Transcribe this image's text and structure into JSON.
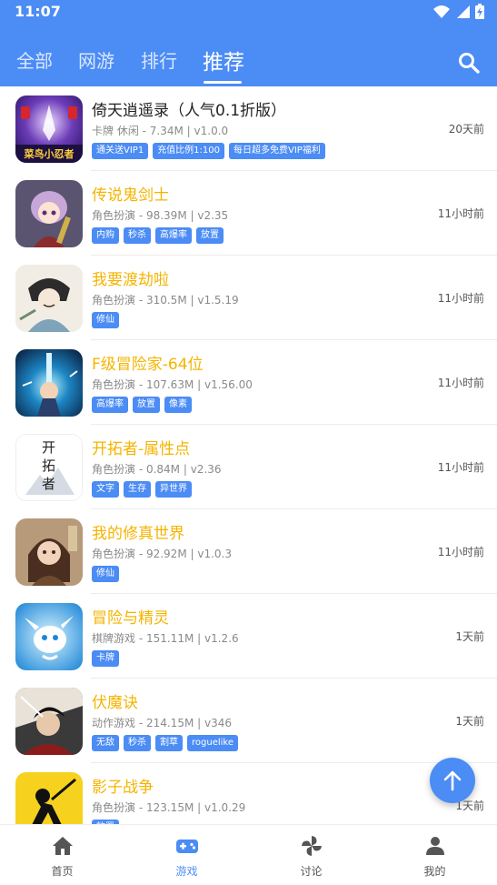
{
  "status": {
    "time": "11:07"
  },
  "tabs": [
    {
      "label": "全部"
    },
    {
      "label": "网游"
    },
    {
      "label": "排行"
    },
    {
      "label": "推荐"
    }
  ],
  "games": [
    {
      "title": "倚天逍遥录（人气0.1折版）",
      "meta": "卡牌 休闲 - 7.34M | v1.0.0",
      "time": "20天前",
      "tags": [
        "通关送VIP1",
        "充值比例1:100",
        "每日超多免费VIP福利"
      ],
      "thumb_caption": "菜鸟小忍者"
    },
    {
      "title": "传说鬼剑士",
      "meta": "角色扮演 - 98.39M | v2.35",
      "time": "11小时前",
      "tags": [
        "内购",
        "秒杀",
        "高爆率",
        "放置"
      ]
    },
    {
      "title": "我要渡劫啦",
      "meta": "角色扮演 - 310.5M | v1.5.19",
      "time": "11小时前",
      "tags": [
        "修仙"
      ]
    },
    {
      "title": "F级冒险家-64位",
      "meta": "角色扮演 - 107.63M | v1.56.00",
      "time": "11小时前",
      "tags": [
        "高爆率",
        "放置",
        "像素"
      ]
    },
    {
      "title": "开拓者-属性点",
      "meta": "角色扮演 - 0.84M | v2.36",
      "time": "11小时前",
      "tags": [
        "文字",
        "生存",
        "异世界"
      ],
      "thumb_caption": "开拓者"
    },
    {
      "title": "我的修真世界",
      "meta": "角色扮演 - 92.92M | v1.0.3",
      "time": "11小时前",
      "tags": [
        "修仙"
      ]
    },
    {
      "title": "冒险与精灵",
      "meta": "棋牌游戏 - 151.11M | v1.2.6",
      "time": "1天前",
      "tags": [
        "卡牌"
      ]
    },
    {
      "title": "伏魔诀",
      "meta": "动作游戏 - 214.15M | v346",
      "time": "1天前",
      "tags": [
        "无敌",
        "秒杀",
        "割草",
        "roguelike"
      ]
    },
    {
      "title": "影子战争",
      "meta": "角色扮演 - 123.15M | v1.0.29",
      "time": "1天前",
      "tags": [
        "放置"
      ]
    }
  ],
  "nav": [
    {
      "label": "首页",
      "icon": "home-icon"
    },
    {
      "label": "游戏",
      "icon": "gamepad-icon"
    },
    {
      "label": "讨论",
      "icon": "pinwheel-icon"
    },
    {
      "label": "我的",
      "icon": "user-icon"
    }
  ],
  "colors": {
    "accent": "#4b8cf5",
    "title_highlight": "#f5b400"
  }
}
